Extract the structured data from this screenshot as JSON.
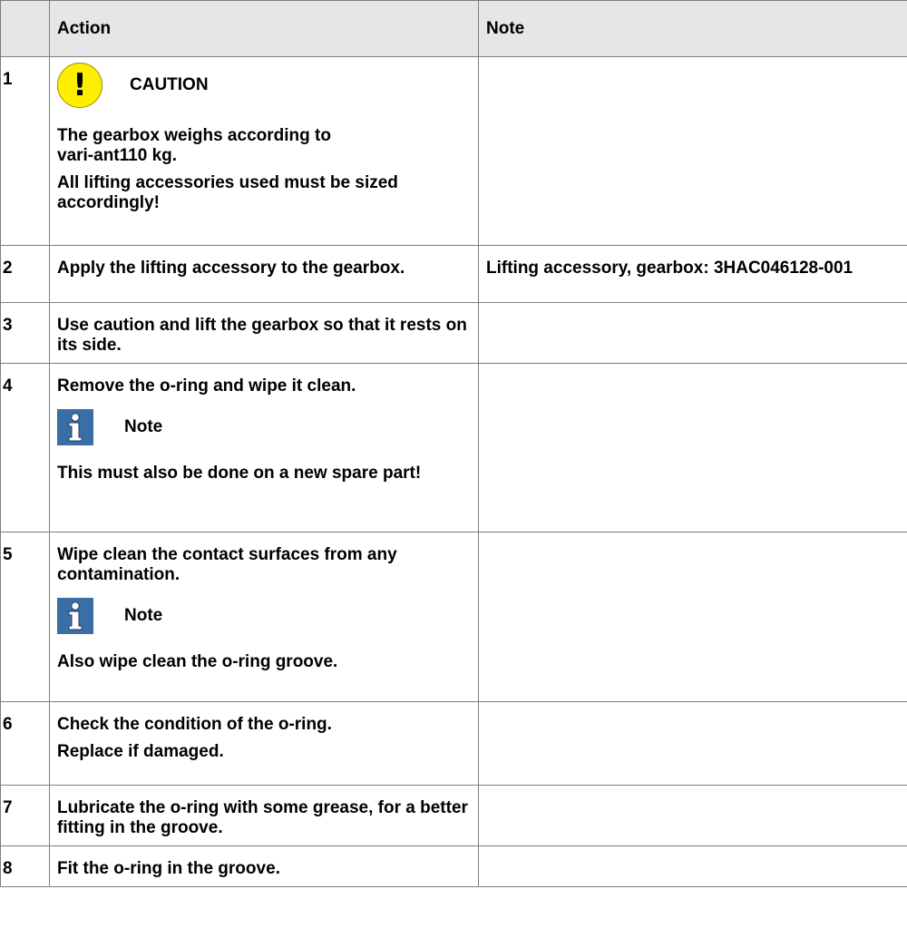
{
  "table": {
    "headers": {
      "number": "",
      "action": "Action",
      "note": "Note"
    },
    "callouts": {
      "caution": "CAUTION",
      "note": "Note"
    },
    "rows": [
      {
        "num": "1",
        "caution_label": "CAUTION",
        "text": [
          "The gearbox weighs according to vari-ant110 kg.",
          "All lifting accessories used must be sized accordingly!"
        ],
        "note": ""
      },
      {
        "num": "2",
        "text": [
          "Apply the lifting accessory to the gearbox."
        ],
        "note": "Lifting accessory, gearbox: 3HAC046128-001"
      },
      {
        "num": "3",
        "text": [
          "Use caution and lift the gearbox so that it rests on its side."
        ],
        "note": ""
      },
      {
        "num": "4",
        "text": [
          "Remove the o-ring and wipe it clean."
        ],
        "note_label": "Note",
        "note_text": "This must also be done on a new spare part!",
        "note": ""
      },
      {
        "num": "5",
        "text": [
          "Wipe clean the contact surfaces from any contamination."
        ],
        "note_label": "Note",
        "note_text": "Also wipe clean the o-ring groove.",
        "note": ""
      },
      {
        "num": "6",
        "text": [
          "Check the condition of the o-ring.",
          "Replace if damaged."
        ],
        "note": ""
      },
      {
        "num": "7",
        "text": [
          "Lubricate the o-ring with some grease, for a better fitting in the groove."
        ],
        "note": ""
      },
      {
        "num": "8",
        "text": [
          "Fit the o-ring in the groove."
        ],
        "note": ""
      }
    ]
  },
  "colors": {
    "header_bg": "#e6e6e6",
    "caution_yellow": "#ffee00",
    "note_blue": "#3a6ea5",
    "border": "#7f7f7f"
  }
}
